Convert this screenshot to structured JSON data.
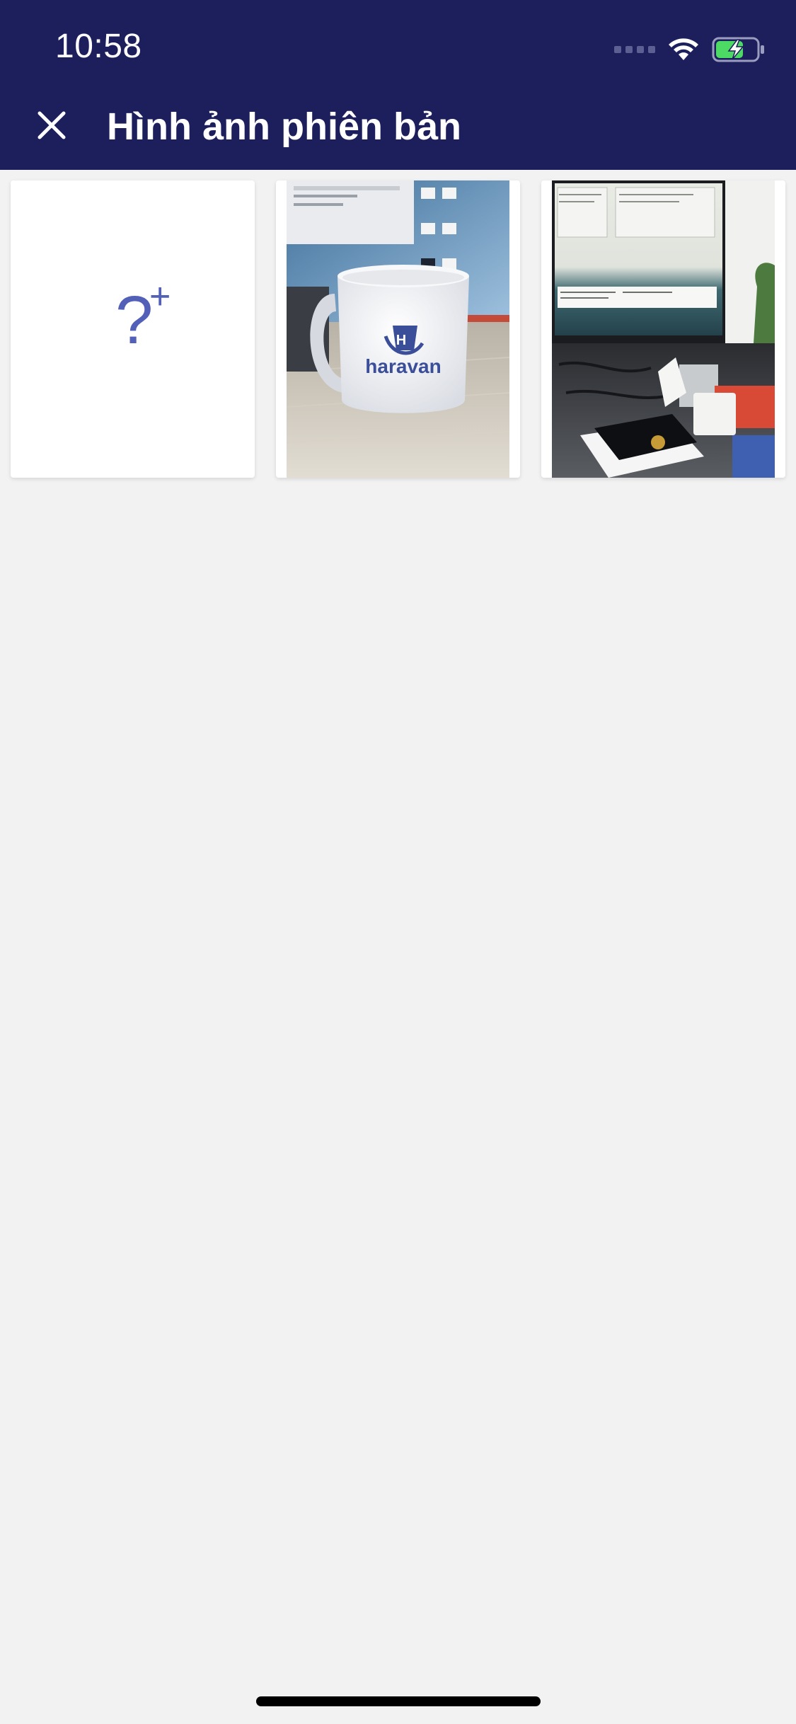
{
  "status_bar": {
    "time": "10:58"
  },
  "header": {
    "title": "Hình ảnh phiên bản",
    "close_icon": "close-icon"
  },
  "add_tile": {
    "glyph": "?",
    "plus": "+"
  },
  "photos": [
    {
      "brand_text": "haravan"
    },
    {
      "brand_text": ""
    }
  ],
  "colors": {
    "header_bg": "#1d1f5c",
    "background": "#f2f2f2",
    "accent": "#5360b8",
    "battery": "#4cd964"
  }
}
